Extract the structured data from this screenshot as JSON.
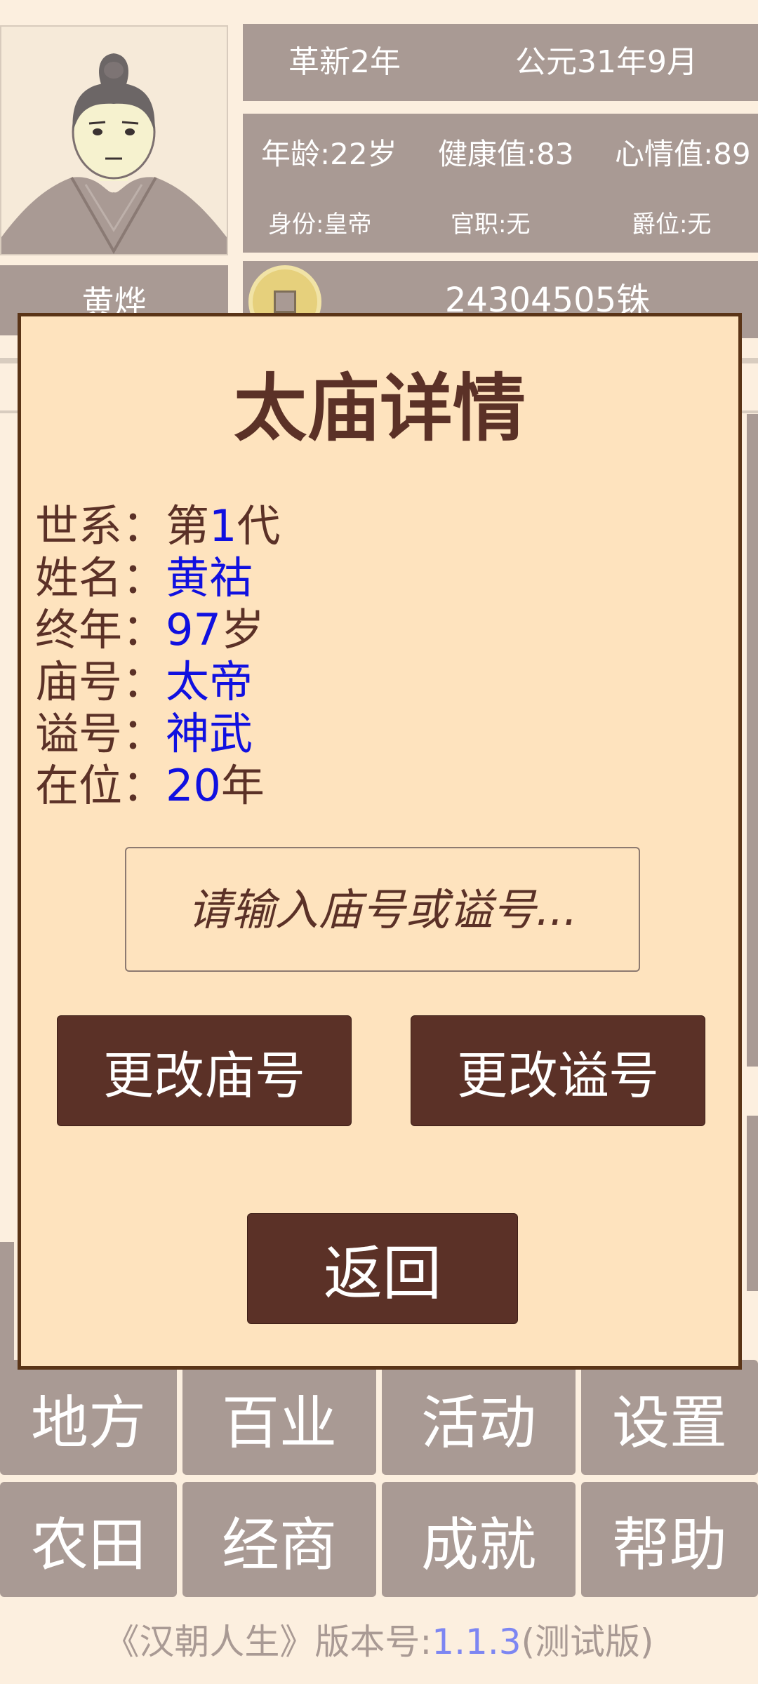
{
  "header": {
    "player_name": "黄烨",
    "era": "革新2年",
    "date": "公元31年9月",
    "stats": {
      "age": "年龄:22岁",
      "health": "健康值:83",
      "mood": "心情值:89",
      "identity": "身份:皇帝",
      "office": "官职:无",
      "rank": "爵位:无"
    },
    "money": "24304505铢",
    "coin_icon": "coin-icon"
  },
  "modal": {
    "title": "太庙详情",
    "rows": [
      {
        "label": "世系：",
        "pre": "第",
        "num": "1",
        "unit": "代"
      },
      {
        "label": "姓名：",
        "value": "黄祜"
      },
      {
        "label": "终年：",
        "num": "97",
        "unit": "岁"
      },
      {
        "label": "庙号：",
        "value": "太帝"
      },
      {
        "label": "谥号：",
        "value": "神武"
      },
      {
        "label": "在位：",
        "num": "20",
        "unit": "年"
      }
    ],
    "input_placeholder": "请输入庙号或谥号...",
    "change_temple_name": "更改庙号",
    "change_posthumous_name": "更改谥号",
    "back": "返回"
  },
  "nav": {
    "row1": [
      "地方",
      "百业",
      "活动",
      "设置"
    ],
    "row2": [
      "农田",
      "经商",
      "成就",
      "帮助"
    ]
  },
  "footer": {
    "prefix": "《汉朝人生》版本号:",
    "version": "1.1.3",
    "suffix": "(测试版)"
  },
  "colors": {
    "background": "#fcefdf",
    "tile": "#a99a94",
    "modal_bg": "#fee3be",
    "modal_border": "#5a3417",
    "button": "#5b3127",
    "accent_value": "#1010e0",
    "version_link": "#7d86f2"
  }
}
